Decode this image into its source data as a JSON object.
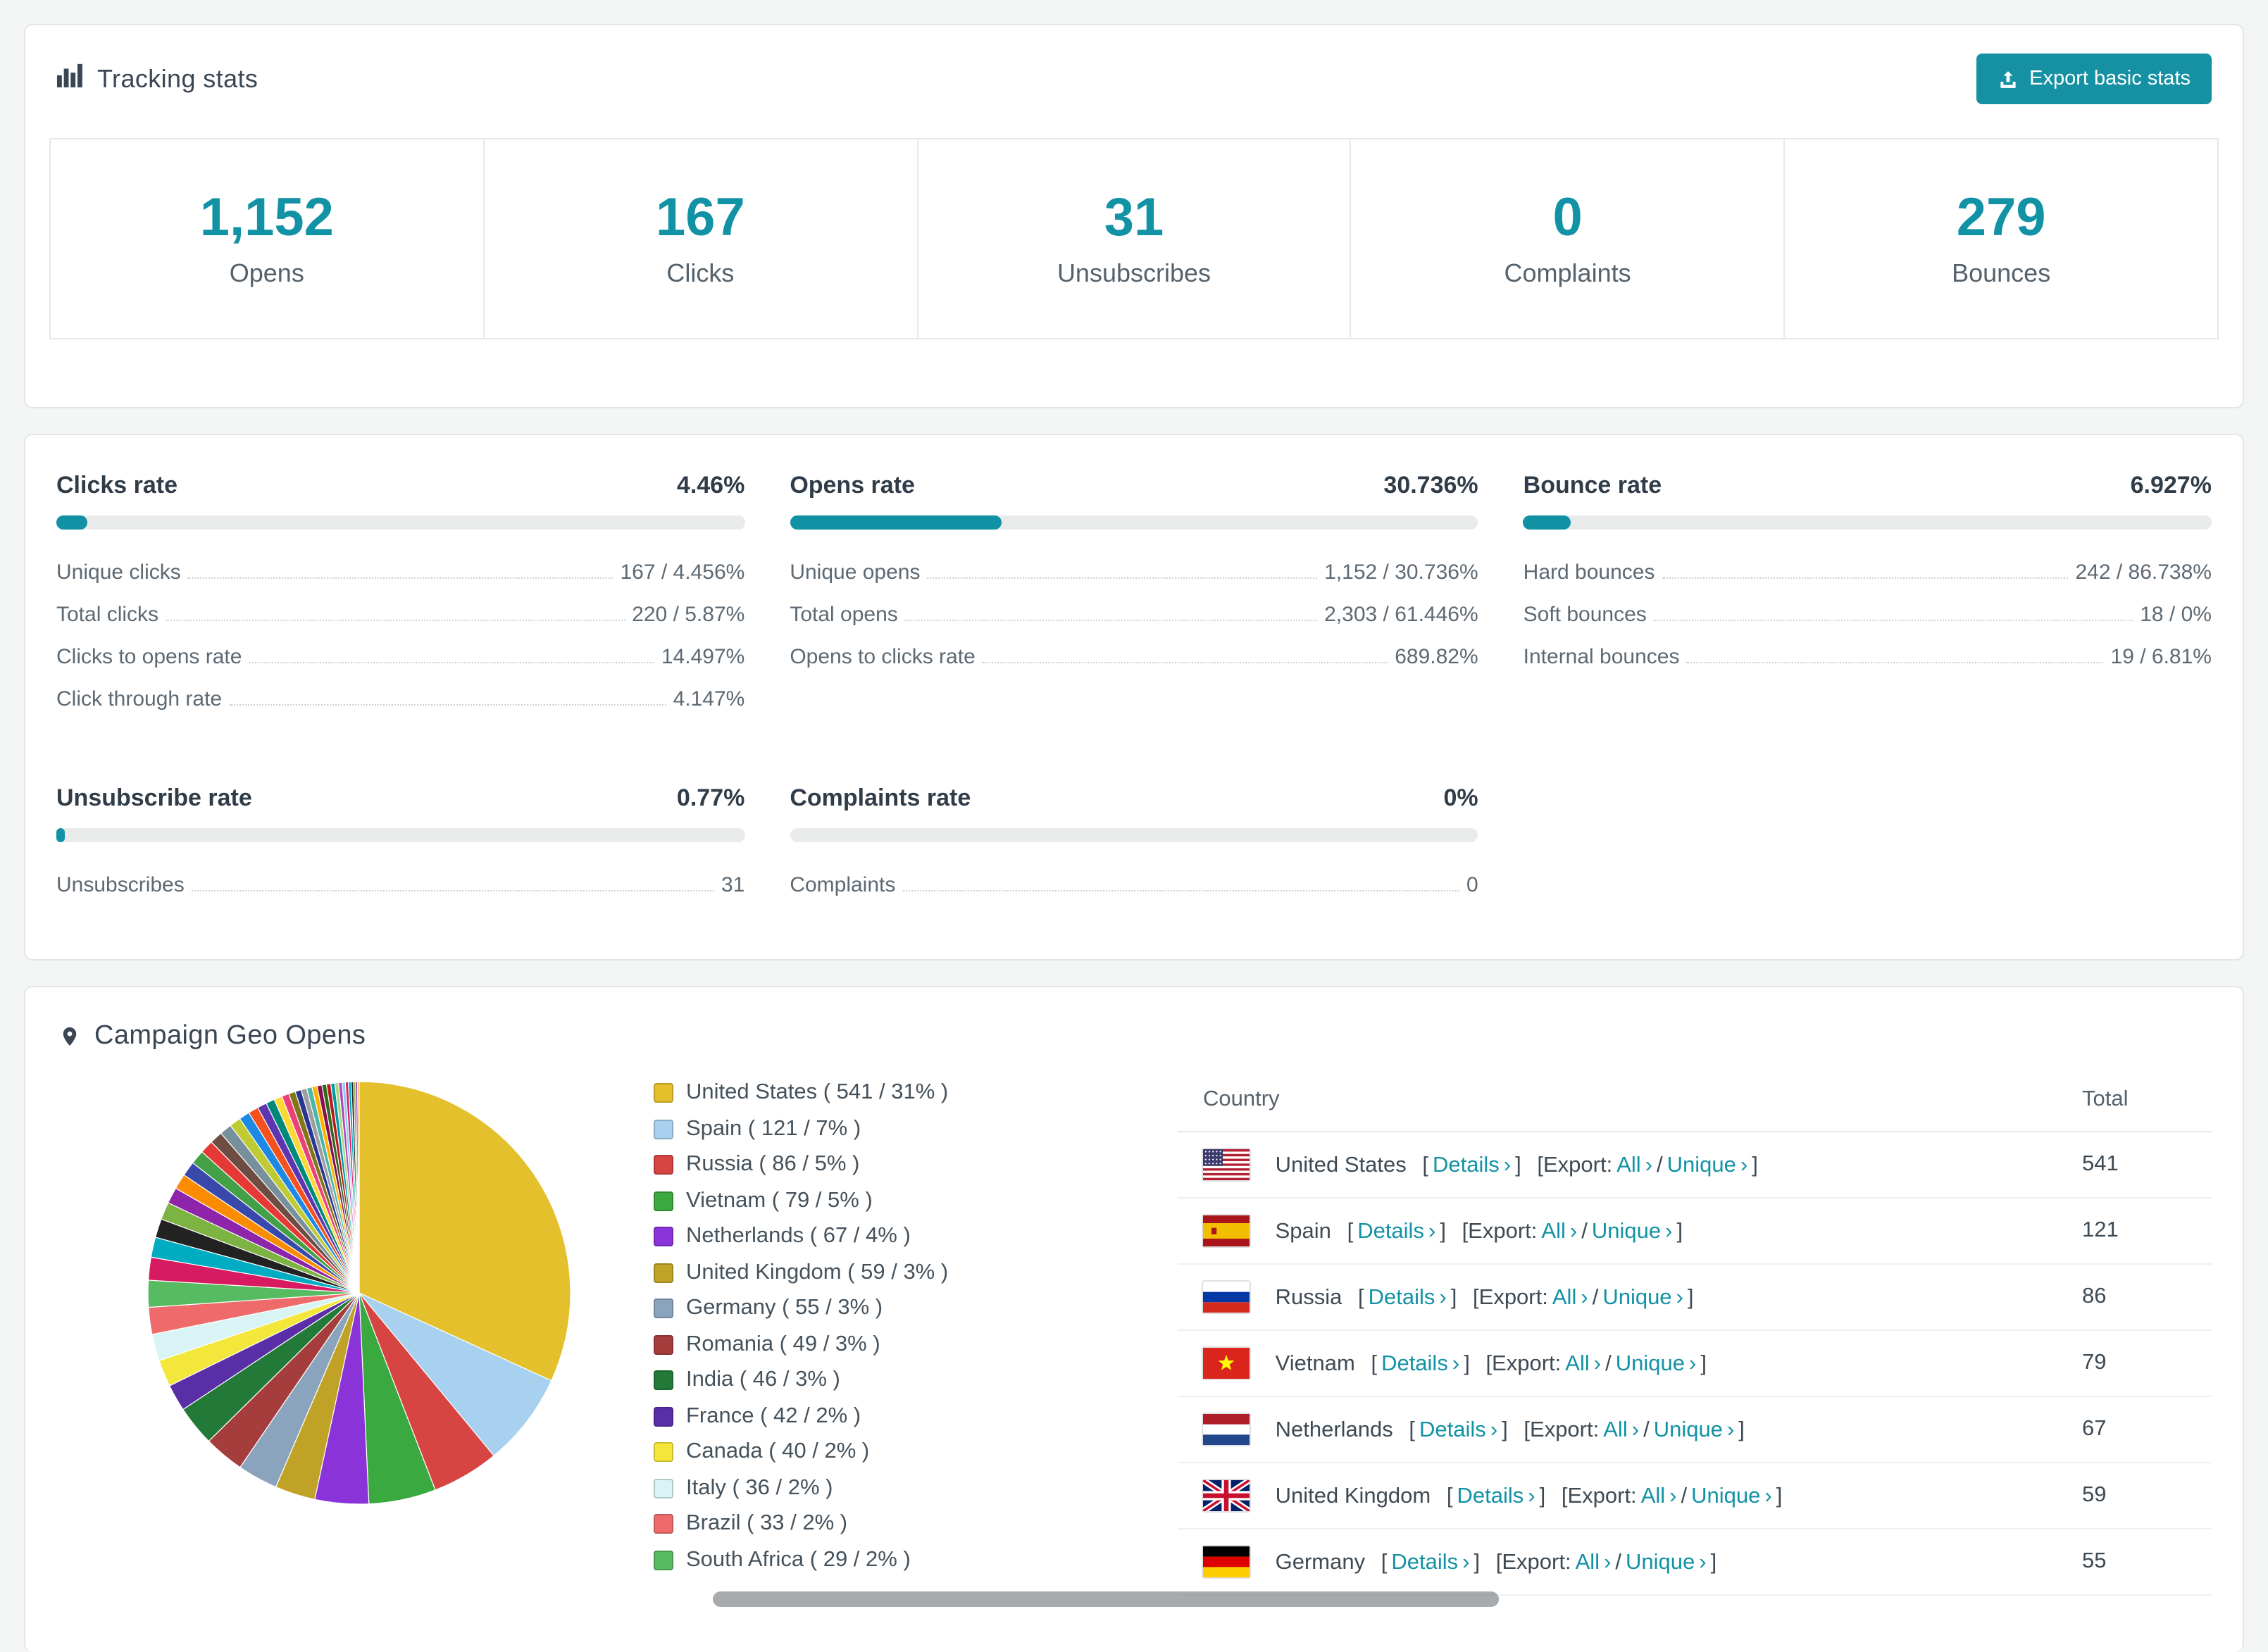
{
  "colors": {
    "accent": "#1292a5",
    "page_bg": "#f4f6f6"
  },
  "tracking": {
    "title": "Tracking stats",
    "export_button": "Export basic stats",
    "stats": [
      {
        "value": "1,152",
        "label": "Opens"
      },
      {
        "value": "167",
        "label": "Clicks"
      },
      {
        "value": "31",
        "label": "Unsubscribes"
      },
      {
        "value": "0",
        "label": "Complaints"
      },
      {
        "value": "279",
        "label": "Bounces"
      }
    ]
  },
  "rates": [
    {
      "title": "Clicks rate",
      "pct_label": "4.46%",
      "pct": 4.46,
      "rows": [
        {
          "label": "Unique clicks",
          "value": "167 / 4.456%"
        },
        {
          "label": "Total clicks",
          "value": "220 / 5.87%"
        },
        {
          "label": "Clicks to opens rate",
          "value": "14.497%"
        },
        {
          "label": "Click through rate",
          "value": "4.147%"
        }
      ]
    },
    {
      "title": "Opens rate",
      "pct_label": "30.736%",
      "pct": 30.736,
      "rows": [
        {
          "label": "Unique opens",
          "value": "1,152 / 30.736%"
        },
        {
          "label": "Total opens",
          "value": "2,303 / 61.446%"
        },
        {
          "label": "Opens to clicks rate",
          "value": "689.82%"
        }
      ]
    },
    {
      "title": "Bounce rate",
      "pct_label": "6.927%",
      "pct": 6.927,
      "rows": [
        {
          "label": "Hard bounces",
          "value": "242 / 86.738%"
        },
        {
          "label": "Soft bounces",
          "value": "18 / 0%"
        },
        {
          "label": "Internal bounces",
          "value": "19 / 6.81%"
        }
      ]
    },
    {
      "title": "Unsubscribe rate",
      "pct_label": "0.77%",
      "pct": 0.77,
      "rows": [
        {
          "label": "Unsubscribes",
          "value": "31"
        }
      ]
    },
    {
      "title": "Complaints rate",
      "pct_label": "0%",
      "pct": 0,
      "rows": [
        {
          "label": "Complaints",
          "value": "0"
        }
      ]
    }
  ],
  "geo": {
    "title": "Campaign Geo Opens",
    "table": {
      "headers": {
        "country": "Country",
        "total": "Total"
      },
      "link_labels": {
        "details": "Details",
        "export": "Export:",
        "all": "All",
        "unique": "Unique"
      },
      "rows": [
        {
          "country": "United States",
          "flag": "us",
          "total": "541"
        },
        {
          "country": "Spain",
          "flag": "es",
          "total": "121"
        },
        {
          "country": "Russia",
          "flag": "ru",
          "total": "86"
        },
        {
          "country": "Vietnam",
          "flag": "vn",
          "total": "79"
        },
        {
          "country": "Netherlands",
          "flag": "nl",
          "total": "67"
        },
        {
          "country": "United Kingdom",
          "flag": "gb",
          "total": "59"
        },
        {
          "country": "Germany",
          "flag": "de",
          "total": "55"
        }
      ]
    }
  },
  "chart_data": {
    "type": "pie",
    "title": "Campaign Geo Opens",
    "legend_position": "right",
    "segments": [
      {
        "label": "United States",
        "value": 541,
        "percent": 31,
        "color": "#e4c02c"
      },
      {
        "label": "Spain",
        "value": 121,
        "percent": 7,
        "color": "#a8d1f0"
      },
      {
        "label": "Russia",
        "value": 86,
        "percent": 5,
        "color": "#d64541"
      },
      {
        "label": "Vietnam",
        "value": 79,
        "percent": 5,
        "color": "#3aa93f"
      },
      {
        "label": "Netherlands",
        "value": 67,
        "percent": 4,
        "color": "#8a33d8"
      },
      {
        "label": "United Kingdom",
        "value": 59,
        "percent": 3,
        "color": "#bfa226"
      },
      {
        "label": "Germany",
        "value": 55,
        "percent": 3,
        "color": "#8aa4bd"
      },
      {
        "label": "Romania",
        "value": 49,
        "percent": 3,
        "color": "#a63d3d"
      },
      {
        "label": "India",
        "value": 46,
        "percent": 3,
        "color": "#237a38"
      },
      {
        "label": "France",
        "value": 42,
        "percent": 2,
        "color": "#5a2ea6"
      },
      {
        "label": "Canada",
        "value": 40,
        "percent": 2,
        "color": "#f4e73b"
      },
      {
        "label": "Italy",
        "value": 36,
        "percent": 2,
        "color": "#d8f4f4"
      },
      {
        "label": "Brazil",
        "value": 33,
        "percent": 2,
        "color": "#ef6b6b"
      },
      {
        "label": "South Africa",
        "value": 29,
        "percent": 2,
        "color": "#57bb61"
      }
    ],
    "other_segments": {
      "percents": [
        1.7,
        1.5,
        1.4,
        1.3,
        1.2,
        1.15,
        1.1,
        1.05,
        1.0,
        0.95,
        0.9,
        0.85,
        0.8,
        0.75,
        0.7,
        0.65,
        0.6,
        0.55,
        0.5,
        0.45,
        0.42,
        0.4,
        0.38,
        0.36,
        0.34,
        0.32,
        0.3,
        0.28,
        0.26,
        0.24,
        0.22,
        0.2,
        0.18,
        0.16,
        0.14,
        0.12
      ],
      "palette": [
        "#d81b60",
        "#00acc1",
        "#222222",
        "#7cb342",
        "#8e24aa",
        "#fb8c00",
        "#3949ab",
        "#43a047",
        "#e53935",
        "#6d4c41",
        "#78909c",
        "#c0ca33",
        "#1e88e5",
        "#f4511e",
        "#5e35b1",
        "#00897b",
        "#fdd835",
        "#ec407a",
        "#827717",
        "#283593",
        "#9e9e9e",
        "#4db6ac",
        "#ffb300",
        "#880e4f",
        "#33691e",
        "#b71c1c",
        "#0097a7",
        "#aed581",
        "#ab47bc",
        "#90caf9"
      ]
    }
  }
}
